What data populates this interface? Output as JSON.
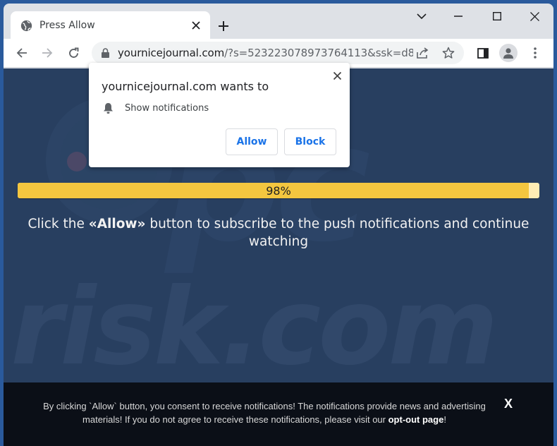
{
  "browser": {
    "tab": {
      "title": "Press Allow",
      "favicon": "globe-icon"
    },
    "new_tab_icon": "plus-icon",
    "window_controls": [
      "tab-search-chevron",
      "minimize",
      "maximize",
      "close"
    ],
    "toolbar": {
      "back_icon": "arrow-left-icon",
      "forward_icon": "arrow-right-icon",
      "reload_icon": "reload-icon",
      "url_domain": "yournicejournal.com",
      "url_rest": "/?s=523223078973764113&ssk=d8...",
      "lock_icon": "lock-icon",
      "share_icon": "share-icon",
      "bookmark_icon": "star-icon",
      "sidepanel_icon": "side-panel-icon",
      "profile_icon": "avatar-icon",
      "menu_icon": "kebab-menu-icon"
    }
  },
  "permission_prompt": {
    "title": "yournicejournal.com wants to",
    "permission": "Show notifications",
    "allow_label": "Allow",
    "block_label": "Block"
  },
  "page": {
    "watermark": "risk.com",
    "progress": {
      "value_percent": 98,
      "label": "98%",
      "fill_color": "#f4c63f",
      "track_color": "#ffedb4"
    },
    "headline_pre": "Click the ",
    "headline_bold": "«Allow»",
    "headline_post": " button to subscribe to the push notifications and continue watching",
    "background_color": "#283f60"
  },
  "banner": {
    "text": "By clicking `Allow` button, you consent to receive notifications! The notifications provide news and advertising materials! If you do not agree to receive these notifications, please visit our ",
    "link_text": "opt-out page",
    "trailing": "!",
    "close_label": "X"
  }
}
